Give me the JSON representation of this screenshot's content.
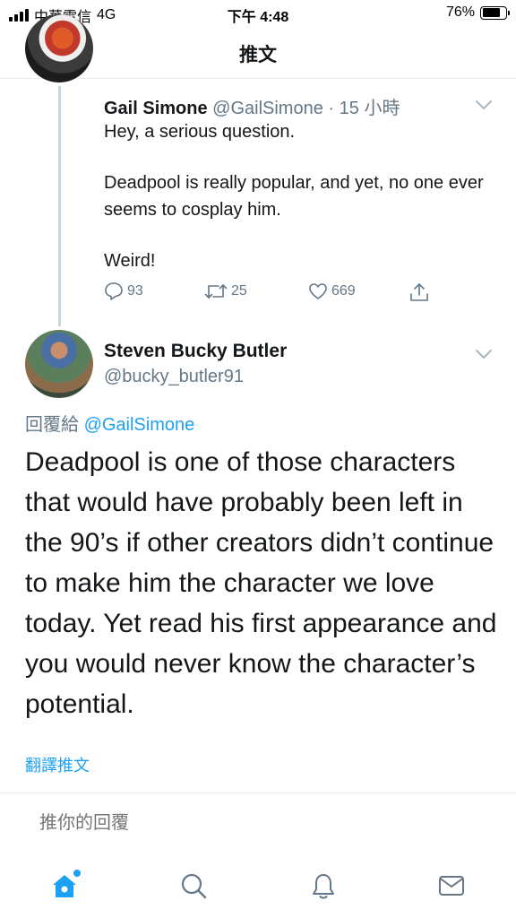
{
  "status_bar": {
    "carrier": "中華電信",
    "network": "4G",
    "time": "下午 4:48",
    "battery": "76%",
    "battery_level": 0.76
  },
  "header": {
    "title": "推文"
  },
  "tweet": {
    "author_name": "Gail Simone",
    "author_handle": "@GailSimone",
    "separator": "·",
    "time": "15 小時",
    "line1": "Hey, a serious question.",
    "line2": "Deadpool is really popular, and yet, no one ever seems to cosplay him.",
    "line3": "Weird!",
    "replies": "93",
    "retweets": "25",
    "likes": "669"
  },
  "reply": {
    "author_name": "Steven Bucky Butler",
    "author_handle": "@bucky_butler91",
    "replying_to_label": "回覆給",
    "replying_to_handle": "@GailSimone",
    "text": "Deadpool is one of those characters that would have probably been left in the 90’s if other creators didn’t continue to make him the character we love today. Yet read his first appearance and you would never know the character’s potential.",
    "translate_label": "翻譯推文"
  },
  "composer": {
    "placeholder": "推你的回覆"
  },
  "colors": {
    "accent": "#1da1f2",
    "secondary_text": "#657786",
    "primary_text": "#14171a"
  },
  "icons": {
    "tabs": [
      "home-icon",
      "search-icon",
      "notifications-icon",
      "messages-icon"
    ]
  }
}
